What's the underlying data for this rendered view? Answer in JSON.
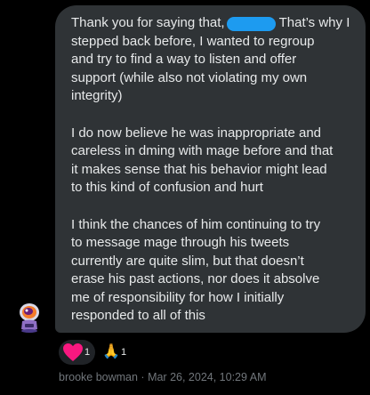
{
  "message": {
    "text_line1_start": "Thank you for saying that,",
    "text_line1_end": "That’s why I",
    "paragraph1_rest": "stepped back before, I wanted to regroup\nand try to find a way to listen and offer\nsupport (while also not violating my own\nintegrity)",
    "paragraph2": "I do now believe he was inappropriate and\ncareless in dming with mage before and that\nit makes sense that his behavior might lead\nto this kind of confusion and hurt",
    "paragraph3": "I think the chances of him continuing to try\nto message mage through his tweets\ncurrently are quite slim, but that doesn’t\nerase his past actions, nor does it absolve\nme of responsibility for how I initially\nresponded to all of this"
  },
  "reactions": [
    {
      "icon": "heart-icon",
      "count": "1",
      "color": "#f91880"
    },
    {
      "icon": "folded-hands-icon",
      "count": "1",
      "color": "#f5c518"
    }
  ],
  "meta": {
    "sender": "brooke bowman",
    "timestamp": "Mar 26, 2024, 10:29 AM",
    "separator": " · "
  },
  "colors": {
    "background": "#000000",
    "bubble": "#2f3336",
    "text": "#e7e9ea",
    "muted": "#71767b",
    "redaction": "#1d9bf0"
  }
}
